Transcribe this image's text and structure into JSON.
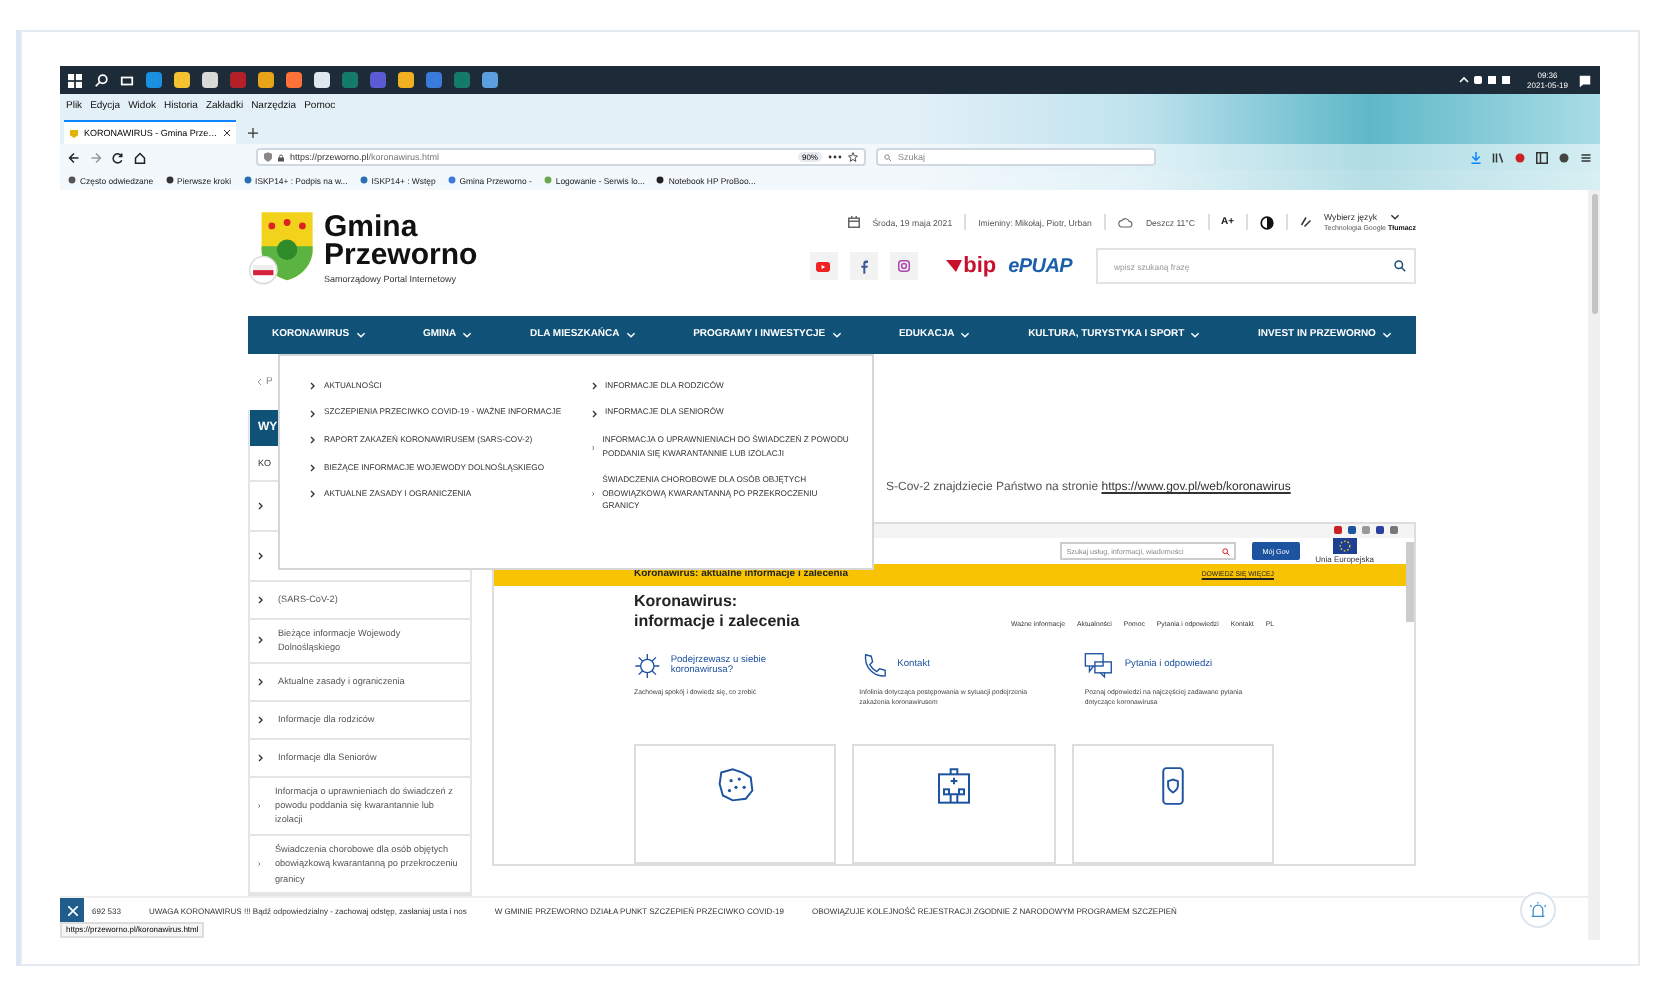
{
  "taskbar": {
    "time": "09:36",
    "date": "2021-05-19",
    "apps": [
      {
        "color": "#1b8fe0"
      },
      {
        "color": "#f2c230"
      },
      {
        "color": "#d9d9d9"
      },
      {
        "color": "#b3202a"
      },
      {
        "color": "#e8a318"
      },
      {
        "color": "#ff7139"
      },
      {
        "color": "#dfe7f0"
      },
      {
        "color": "#167a6a"
      },
      {
        "color": "#5b5bd6"
      },
      {
        "color": "#f0b020"
      },
      {
        "color": "#3a7ad8"
      },
      {
        "color": "#167a6a"
      },
      {
        "color": "#5aa0e0"
      }
    ]
  },
  "browser": {
    "menu": [
      "Plik",
      "Edycja",
      "Widok",
      "Historia",
      "Zakładki",
      "Narzędzia",
      "Pomoc"
    ],
    "tabs": [
      {
        "label": "KORONAWIRUS - Gmina Prze…",
        "selected": true
      }
    ],
    "url_host": "https://przeworno.pl",
    "url_path": "/koronawirus.html",
    "zoom": "90%",
    "search_placeholder": "Szukaj",
    "bookmarks": [
      "Często odwiedzane",
      "Pierwsze kroki",
      "ISKP14+ : Podpis na w...",
      "ISKP14+ : Wstęp",
      "Gmina Przeworno -",
      "Logowanie - Serwis lo...",
      "Notebook HP ProBoo..."
    ]
  },
  "site": {
    "logo": {
      "line1": "Gmina",
      "line2": "Przeworno",
      "tagline": "Samorządowy Portal Internetowy"
    },
    "date": "Środa, 19 maja 2021",
    "nameday": "Imieniny: Mikołaj, Piotr, Urban",
    "weather": "Deszcz 11°C",
    "font_size": "A+",
    "language": "Wybierz język",
    "translate": {
      "prefix": "Technologia",
      "brand": "Google",
      "name": "Tłumacz"
    },
    "bip": "bip",
    "epuap": "ePUAP",
    "search_placeholder": "wpisz szukaną frazę",
    "nav": [
      "KORONAWIRUS",
      "GMINA",
      "DLA MIESZKAŃCA",
      "PROGRAMY I INWESTYCJE",
      "EDUKACJA",
      "KULTURA, TURYSTYKA I SPORT",
      "INVEST IN PRZEWORNO"
    ],
    "dropdown": {
      "columns": [
        [
          "AKTUALNOŚCI",
          "SZCZEPIENIA PRZECIWKO COVID-19 - WAŻNE INFORMACJE",
          "RAPORT ZAKAŻEŃ KORONAWIRUSEM (SARS-COV-2)",
          "BIEŻĄCE INFORMACJE WOJEWODY DOLNOŚLĄSKIEGO",
          "AKTUALNE ZASADY I OGRANICZENIA"
        ],
        [
          "INFORMACJE DLA RODZICÓW",
          "INFORMACJE DLA SENIORÓW",
          "INFORMACJA O UPRAWNIENIACH DO ŚWIADCZEŃ Z POWODU PODDANIA SIĘ KWARANTANNIE LUB IZOLACJI",
          "ŚWIADCZENIA CHOROBOWE DLA OSÓB OBJĘTYCH OBOWIĄZKOWĄ KWARANTANNĄ PO PRZEKROCZENIU GRANICY"
        ]
      ]
    },
    "breadcrumb": "P",
    "sidebar": {
      "title": "WY",
      "subtitle": "KO",
      "items": [
        {
          "kind": "covered"
        },
        {
          "kind": "covered"
        },
        {
          "kind": "link",
          "label": "(SARS-CoV-2)"
        },
        {
          "kind": "link",
          "label": "Bieżące informacje Wojewody Dolnośląskiego"
        },
        {
          "kind": "link",
          "label": "Aktualne zasady i ograniczenia"
        },
        {
          "kind": "link",
          "label": "Informacje dla rodziców"
        },
        {
          "kind": "link",
          "label": "Informacje dla Seniorów"
        },
        {
          "kind": "link",
          "label": "Informacja o uprawnieniach do świadczeń z powodu poddania się kwarantannie lub izolacji"
        },
        {
          "kind": "link",
          "label": "Świadczenia chorobowe dla osób objętych obowiązkową kwarantanną po przekroczeniu granicy"
        }
      ]
    },
    "intro": "S-Cov-2 znajdziecie Państwo na stronie",
    "intro_link": "https://www.gov.pl/web/koronawirus",
    "embedded": {
      "search_placeholder": "Szukaj usług, informacji, wiadomości",
      "account_button": "Mój Gov",
      "eu_label": "Unia Europejska",
      "banner": "Koronawirus: aktualne informacje i zalecenia",
      "banner_link": "DOWIEDZ SIĘ WIĘCEJ",
      "title_line1": "Koronawirus:",
      "title_line2": "informacje i zalecenia",
      "nav": [
        "Ważne informacje",
        "Aktualności",
        "Pomoc",
        "Pytania i odpowiedzi",
        "Kontakt",
        "PL"
      ],
      "features": [
        {
          "kind": "virus",
          "title": "Podejrzewasz u siebie koronawirusa?",
          "text": "Zachowaj spokój i dowiedz się, co zrobić"
        },
        {
          "kind": "phone",
          "title": "Kontakt",
          "text": "Infolinia dotycząca postępowania w sytuacji podejrzenia zakażenia koronawirusem"
        },
        {
          "kind": "chat",
          "title": "Pytania i odpowiedzi",
          "text": "Poznaj odpowiedzi na najczęściej zadawane pytania dotyczące koronawirusa"
        }
      ],
      "cards": [
        {
          "kind": "map"
        },
        {
          "kind": "building"
        },
        {
          "kind": "mobile"
        }
      ]
    },
    "ticker": {
      "phone": "692 533",
      "messages": [
        "UWAGA KORONAWIRUS !!! Bądź odpowiedzialny - zachowaj odstęp, zasłaniaj usta i nos",
        "W GMINIE PRZEWORNO DZIAŁA PUNKT SZCZEPIEŃ PRZECIWKO COVID-19",
        "OBOWIĄZUJE KOLEJNOŚĆ REJESTRACJI ZGODNIE Z NARODOWYM PROGRAMEM SZCZEPIEŃ"
      ]
    },
    "status_url": "https://przeworno.pl/koronawirus.html"
  }
}
